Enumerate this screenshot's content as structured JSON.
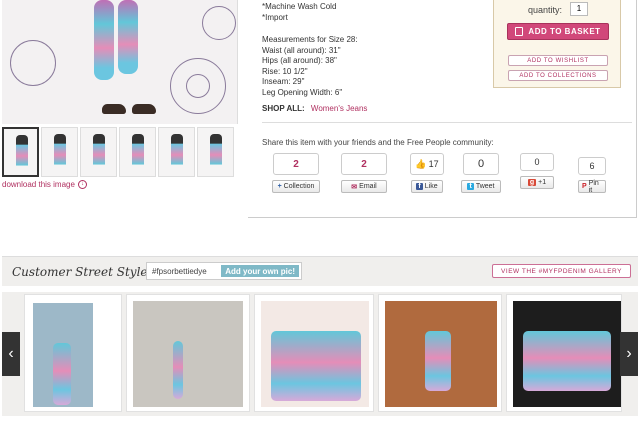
{
  "product": {
    "care": [
      "*Machine Wash Cold",
      "*Import"
    ],
    "measurements": [
      "Measurements for Size 28:",
      "Waist (all around): 31\"",
      "Hips (all around): 38\"",
      "Rise: 10 1/2\"",
      "Inseam: 29\"",
      "Leg Opening Width: 6\""
    ],
    "shop_all_label": "SHOP ALL:",
    "shop_all_link": "Women's Jeans"
  },
  "purchase": {
    "quantity_label": "quantity:",
    "quantity_value": "1",
    "add_to_basket": "ADD TO BASKET",
    "add_to_wishlist": "ADD TO WISHLIST",
    "add_to_collections": "ADD TO COLLECTIONS"
  },
  "gallery": {
    "download_label": "download this image",
    "thumbnail_count": 6
  },
  "share": {
    "prompt": "Share this item with your friends and the Free People community:",
    "items": [
      {
        "count": "2",
        "label": "Collection",
        "icon": "plus-icon"
      },
      {
        "count": "2",
        "label": "Email",
        "icon": "mail-icon"
      },
      {
        "count": "17",
        "label": "Like",
        "icon": "facebook-icon"
      },
      {
        "count": "0",
        "label": "Tweet",
        "icon": "twitter-icon"
      },
      {
        "count": "0",
        "label": "+1",
        "icon": "googleplus-icon"
      },
      {
        "count": "6",
        "label": "Pin it",
        "icon": "pinterest-icon"
      }
    ]
  },
  "street_style": {
    "title": "Customer Street Style",
    "hashtag": "#fpsorbettiedye",
    "add_pic": "Add your own pic!",
    "gallery_link": "VIEW THE #MYFPDENIM GALLERY",
    "prev_arrow": "‹",
    "next_arrow": "›"
  },
  "colors": {
    "accent": "#b03060",
    "basket_button": "#d1487a",
    "basket_box": "#fbf6e9",
    "add_pic": "#7fb9c7"
  }
}
